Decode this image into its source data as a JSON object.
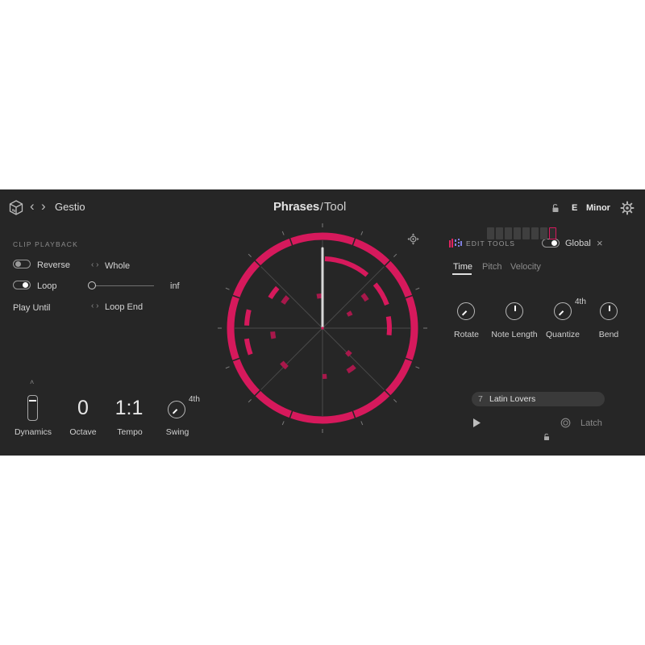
{
  "header": {
    "back_symbol": "‹",
    "forward_symbol": "›",
    "preset_name": "Gestio",
    "title_bold": "Phrases",
    "title_light": "Tool",
    "key_root": "E",
    "key_scale": "Minor"
  },
  "clip_playback": {
    "heading": "CLIP PLAYBACK",
    "reverse_label": "Reverse",
    "reverse_on": false,
    "direction_value": "Whole",
    "loop_label": "Loop",
    "loop_on": true,
    "loop_value": "inf",
    "loop_slider_level": 0.0,
    "play_until_label": "Play Until",
    "play_until_value": "Loop End"
  },
  "performance": {
    "dynamics_label": "Dynamics",
    "octave_value": "0",
    "octave_label": "Octave",
    "tempo_value": "1:1",
    "tempo_label": "Tempo",
    "swing_value": "4th",
    "swing_label": "Swing"
  },
  "edit_tools": {
    "heading": "EDIT TOOLS",
    "global_label": "Global",
    "global_on": true,
    "close_symbol": "×",
    "tabs": [
      {
        "label": "Time",
        "active": true
      },
      {
        "label": "Pitch",
        "active": false
      },
      {
        "label": "Velocity",
        "active": false
      }
    ],
    "knobs": [
      {
        "label": "Rotate",
        "value": ""
      },
      {
        "label": "Note Length",
        "value": ""
      },
      {
        "label": "Quantize",
        "value": "4th"
      },
      {
        "label": "Bend",
        "value": ""
      }
    ]
  },
  "phrase": {
    "number": "7",
    "name": "Latin Lovers",
    "latch_label": "Latch",
    "steps_total": 8,
    "active_step": 8
  },
  "colors": {
    "panel_bg": "#262626",
    "accent": "#d6195c",
    "accent_dim": "#a8184b",
    "text": "#d4d4d4",
    "muted": "#8a8a8a"
  }
}
